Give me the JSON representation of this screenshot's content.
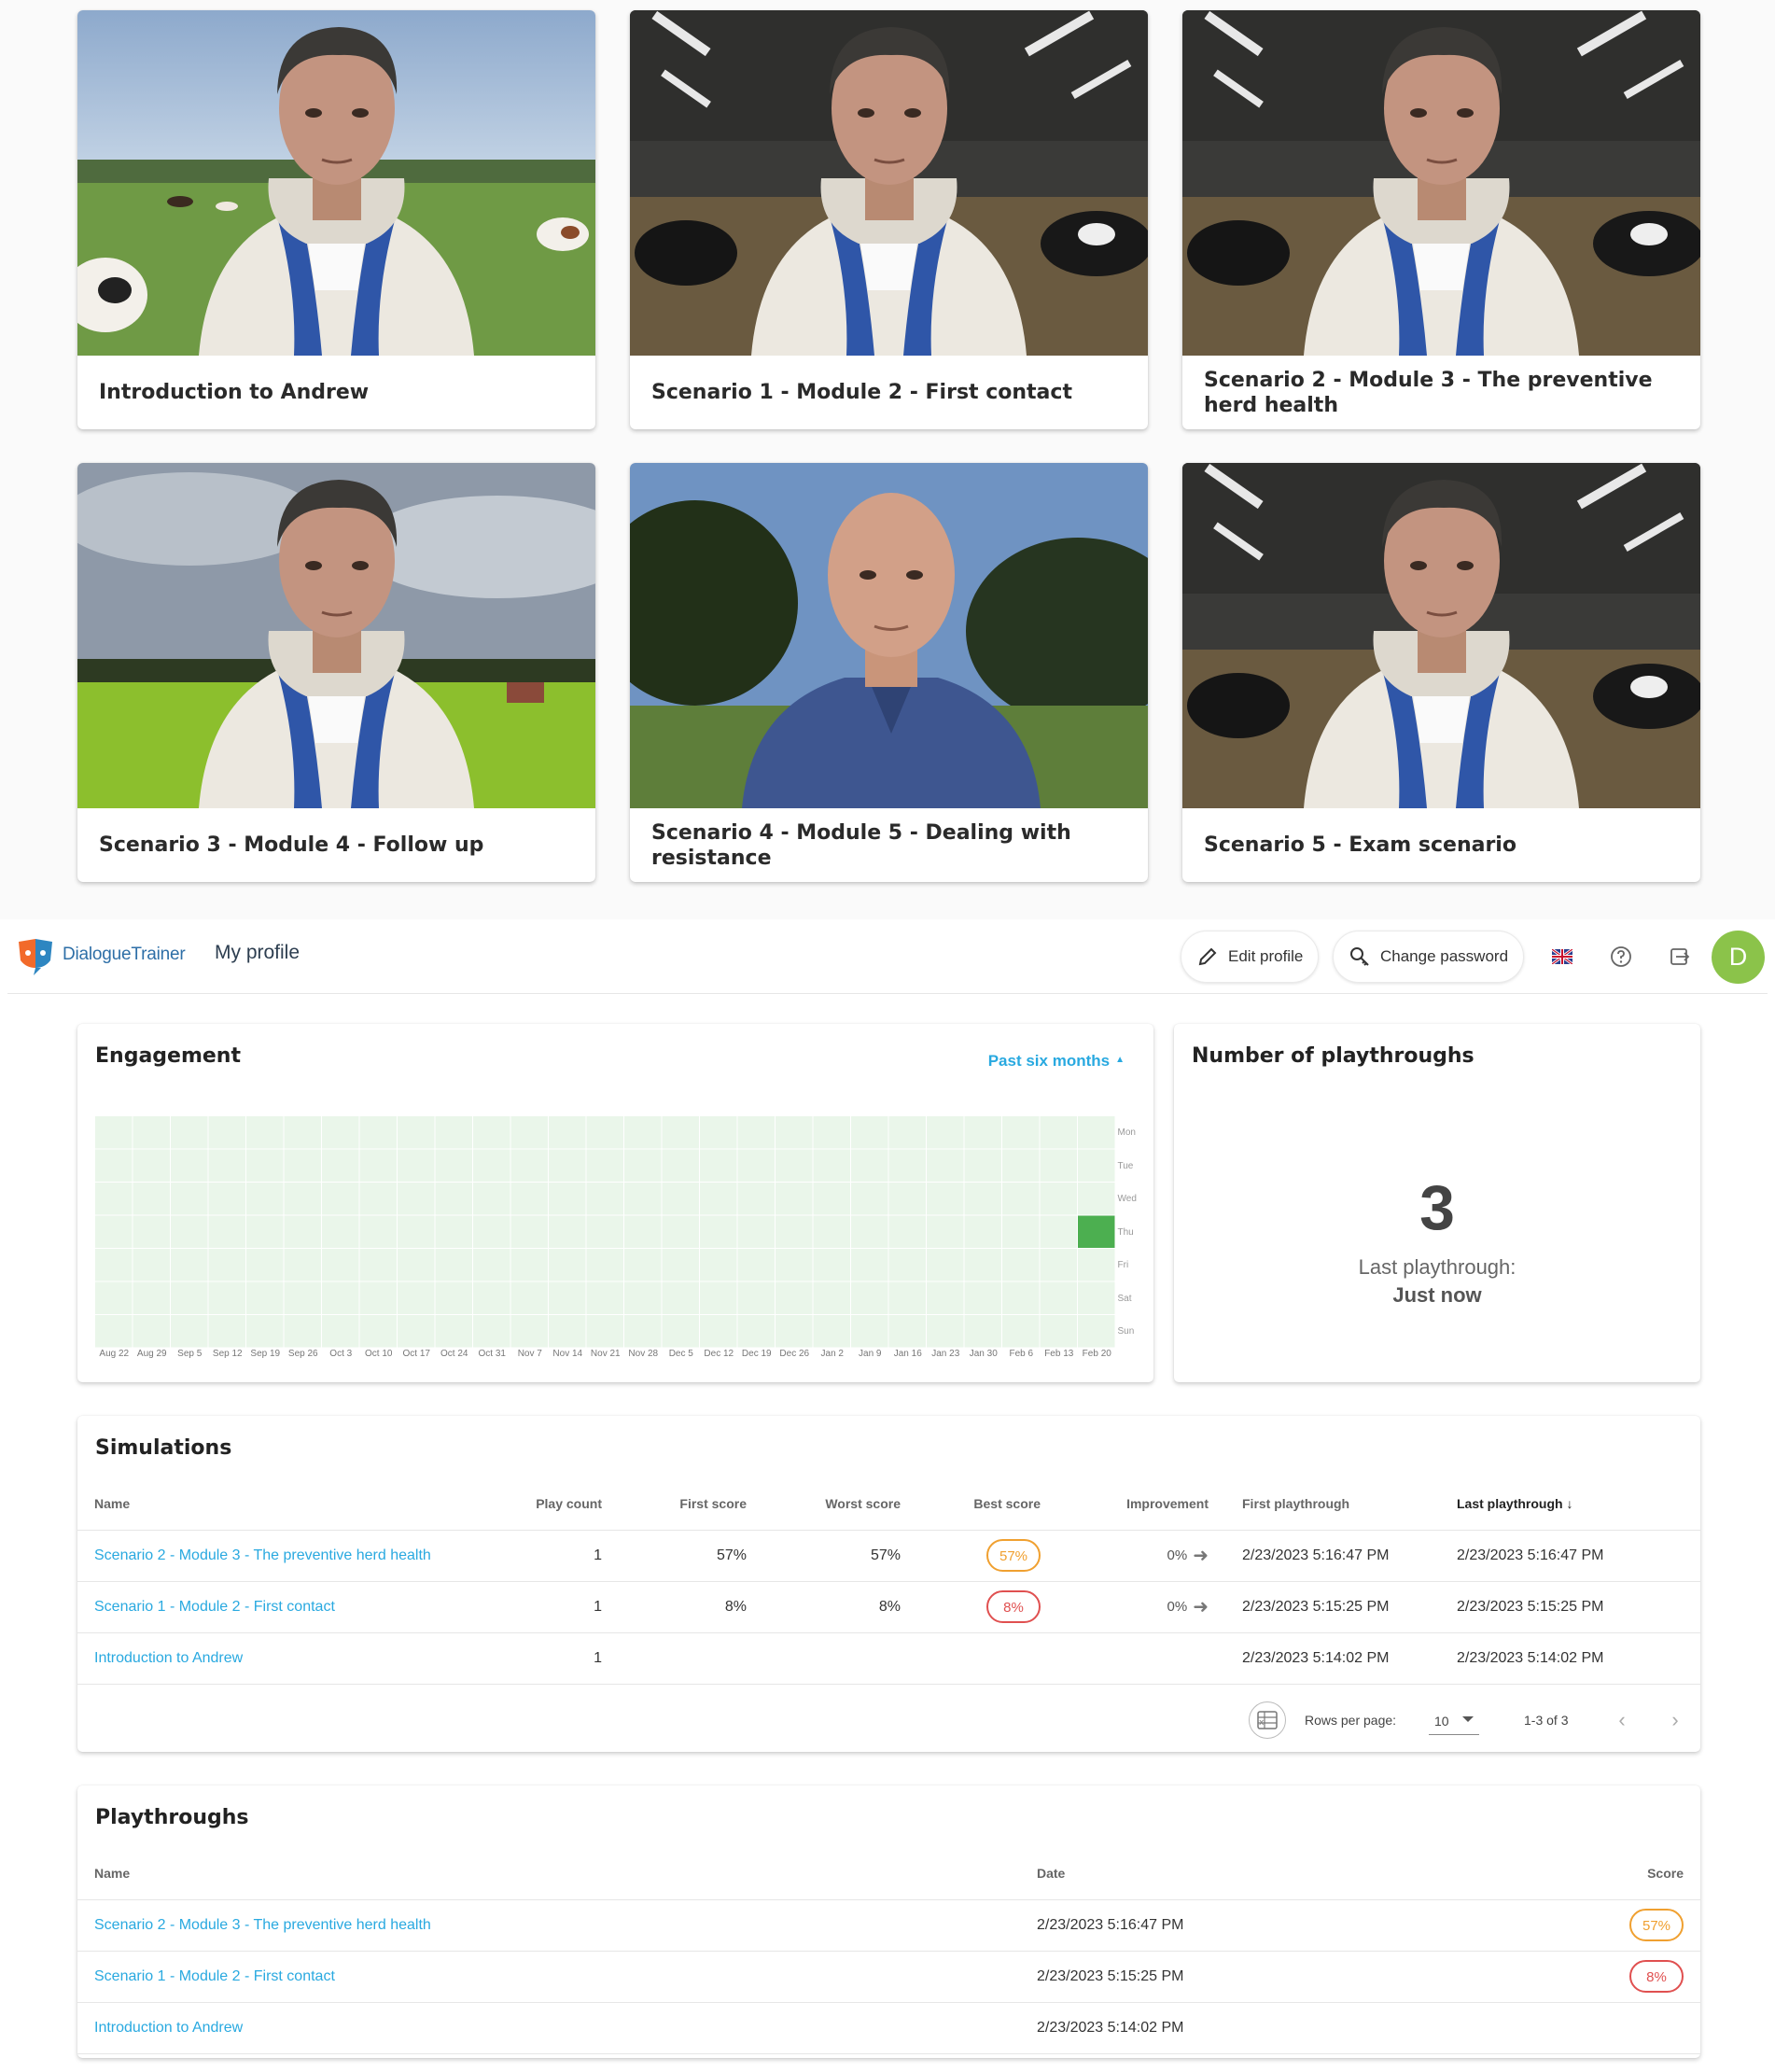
{
  "scenarios": [
    {
      "title": "Introduction to Andrew"
    },
    {
      "title": "Scenario 1 - Module 2 - First contact"
    },
    {
      "title": "Scenario 2 - Module 3 - The preventive herd health"
    },
    {
      "title": "Scenario 3 - Module 4 - Follow up"
    },
    {
      "title": "Scenario 4 - Module 5 - Dealing with resistance"
    },
    {
      "title": "Scenario 5 - Exam scenario"
    }
  ],
  "header": {
    "brand": "DialogueTrainer",
    "page_title": "My profile",
    "edit_profile": "Edit profile",
    "change_password": "Change password",
    "avatar_initial": "D"
  },
  "engagement": {
    "title": "Engagement",
    "range": "Past six months",
    "days": [
      "Mon",
      "Tue",
      "Wed",
      "Thu",
      "Fri",
      "Sat",
      "Sun"
    ],
    "weeks": [
      "Aug 22",
      "Aug 29",
      "Sep 5",
      "Sep 12",
      "Sep 19",
      "Sep 26",
      "Oct 3",
      "Oct 10",
      "Oct 17",
      "Oct 24",
      "Oct 31",
      "Nov 7",
      "Nov 14",
      "Nov 21",
      "Nov 28",
      "Dec 5",
      "Dec 12",
      "Dec 19",
      "Dec 26",
      "Jan 2",
      "Jan 9",
      "Jan 16",
      "Jan 23",
      "Jan 30",
      "Feb 6",
      "Feb 13",
      "Feb 20"
    ],
    "active": [
      {
        "week": "Feb 20",
        "day": "Thu",
        "count": 3
      }
    ],
    "colors": {
      "empty": "#eaf6ea",
      "active": "#4caf50"
    }
  },
  "playthroughs_count": {
    "title": "Number of playthroughs",
    "value": "3",
    "last_label": "Last playthrough:",
    "last_value": "Just now"
  },
  "simulations": {
    "title": "Simulations",
    "columns": {
      "name": "Name",
      "play_count": "Play count",
      "first_score": "First score",
      "worst_score": "Worst score",
      "best_score": "Best score",
      "improvement": "Improvement",
      "first_playthrough": "First playthrough",
      "last_playthrough": "Last playthrough"
    },
    "rows": [
      {
        "name": "Scenario 2 - Module 3 - The preventive herd health",
        "play_count": "1",
        "first_score": "57%",
        "worst_score": "57%",
        "best_score": "57%",
        "improvement": "0%",
        "first_playthrough": "2/23/2023 5:16:47 PM",
        "last_playthrough": "2/23/2023 5:16:47 PM"
      },
      {
        "name": "Scenario 1 - Module 2 - First contact",
        "play_count": "1",
        "first_score": "8%",
        "worst_score": "8%",
        "best_score": "8%",
        "improvement": "0%",
        "first_playthrough": "2/23/2023 5:15:25 PM",
        "last_playthrough": "2/23/2023 5:15:25 PM"
      },
      {
        "name": "Introduction to Andrew",
        "play_count": "1",
        "first_score": "",
        "worst_score": "",
        "best_score": "",
        "improvement": "",
        "first_playthrough": "2/23/2023 5:14:02 PM",
        "last_playthrough": "2/23/2023 5:14:02 PM"
      }
    ],
    "pager": {
      "rows_per_page_label": "Rows per page:",
      "rows_per_page": "10",
      "range": "1-3 of 3"
    }
  },
  "playthroughs": {
    "title": "Playthroughs",
    "columns": {
      "name": "Name",
      "date": "Date",
      "score": "Score"
    },
    "rows": [
      {
        "name": "Scenario 2 - Module 3 - The preventive herd health",
        "date": "2/23/2023 5:16:47 PM",
        "score": "57%"
      },
      {
        "name": "Scenario 1 - Module 2 - First contact",
        "date": "2/23/2023 5:15:25 PM",
        "score": "8%"
      },
      {
        "name": "Introduction to Andrew",
        "date": "2/23/2023 5:14:02 PM",
        "score": ""
      }
    ]
  },
  "score_colors": {
    "mid": "#f0a030",
    "low": "#e05050"
  }
}
